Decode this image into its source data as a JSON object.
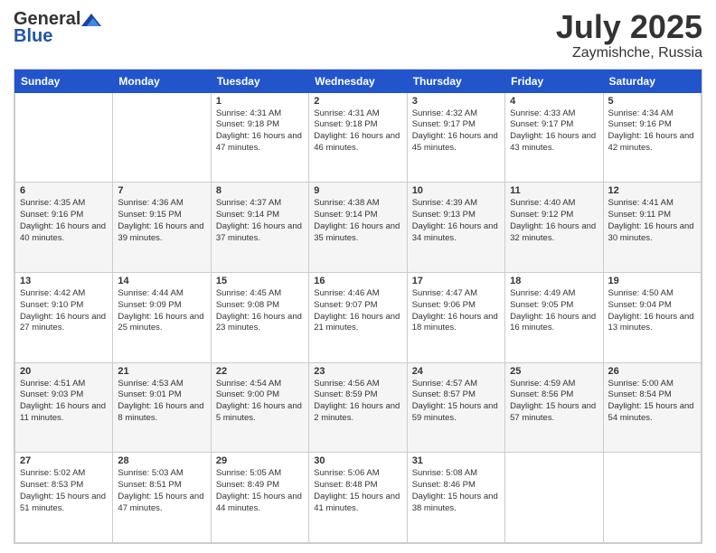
{
  "header": {
    "logo_general": "General",
    "logo_blue": "Blue",
    "month_title": "July 2025",
    "location": "Zaymishche, Russia"
  },
  "calendar": {
    "days_of_week": [
      "Sunday",
      "Monday",
      "Tuesday",
      "Wednesday",
      "Thursday",
      "Friday",
      "Saturday"
    ],
    "weeks": [
      [
        {
          "day": "",
          "info": ""
        },
        {
          "day": "",
          "info": ""
        },
        {
          "day": "1",
          "info": "Sunrise: 4:31 AM\nSunset: 9:18 PM\nDaylight: 16 hours and 47 minutes."
        },
        {
          "day": "2",
          "info": "Sunrise: 4:31 AM\nSunset: 9:18 PM\nDaylight: 16 hours and 46 minutes."
        },
        {
          "day": "3",
          "info": "Sunrise: 4:32 AM\nSunset: 9:17 PM\nDaylight: 16 hours and 45 minutes."
        },
        {
          "day": "4",
          "info": "Sunrise: 4:33 AM\nSunset: 9:17 PM\nDaylight: 16 hours and 43 minutes."
        },
        {
          "day": "5",
          "info": "Sunrise: 4:34 AM\nSunset: 9:16 PM\nDaylight: 16 hours and 42 minutes."
        }
      ],
      [
        {
          "day": "6",
          "info": "Sunrise: 4:35 AM\nSunset: 9:16 PM\nDaylight: 16 hours and 40 minutes."
        },
        {
          "day": "7",
          "info": "Sunrise: 4:36 AM\nSunset: 9:15 PM\nDaylight: 16 hours and 39 minutes."
        },
        {
          "day": "8",
          "info": "Sunrise: 4:37 AM\nSunset: 9:14 PM\nDaylight: 16 hours and 37 minutes."
        },
        {
          "day": "9",
          "info": "Sunrise: 4:38 AM\nSunset: 9:14 PM\nDaylight: 16 hours and 35 minutes."
        },
        {
          "day": "10",
          "info": "Sunrise: 4:39 AM\nSunset: 9:13 PM\nDaylight: 16 hours and 34 minutes."
        },
        {
          "day": "11",
          "info": "Sunrise: 4:40 AM\nSunset: 9:12 PM\nDaylight: 16 hours and 32 minutes."
        },
        {
          "day": "12",
          "info": "Sunrise: 4:41 AM\nSunset: 9:11 PM\nDaylight: 16 hours and 30 minutes."
        }
      ],
      [
        {
          "day": "13",
          "info": "Sunrise: 4:42 AM\nSunset: 9:10 PM\nDaylight: 16 hours and 27 minutes."
        },
        {
          "day": "14",
          "info": "Sunrise: 4:44 AM\nSunset: 9:09 PM\nDaylight: 16 hours and 25 minutes."
        },
        {
          "day": "15",
          "info": "Sunrise: 4:45 AM\nSunset: 9:08 PM\nDaylight: 16 hours and 23 minutes."
        },
        {
          "day": "16",
          "info": "Sunrise: 4:46 AM\nSunset: 9:07 PM\nDaylight: 16 hours and 21 minutes."
        },
        {
          "day": "17",
          "info": "Sunrise: 4:47 AM\nSunset: 9:06 PM\nDaylight: 16 hours and 18 minutes."
        },
        {
          "day": "18",
          "info": "Sunrise: 4:49 AM\nSunset: 9:05 PM\nDaylight: 16 hours and 16 minutes."
        },
        {
          "day": "19",
          "info": "Sunrise: 4:50 AM\nSunset: 9:04 PM\nDaylight: 16 hours and 13 minutes."
        }
      ],
      [
        {
          "day": "20",
          "info": "Sunrise: 4:51 AM\nSunset: 9:03 PM\nDaylight: 16 hours and 11 minutes."
        },
        {
          "day": "21",
          "info": "Sunrise: 4:53 AM\nSunset: 9:01 PM\nDaylight: 16 hours and 8 minutes."
        },
        {
          "day": "22",
          "info": "Sunrise: 4:54 AM\nSunset: 9:00 PM\nDaylight: 16 hours and 5 minutes."
        },
        {
          "day": "23",
          "info": "Sunrise: 4:56 AM\nSunset: 8:59 PM\nDaylight: 16 hours and 2 minutes."
        },
        {
          "day": "24",
          "info": "Sunrise: 4:57 AM\nSunset: 8:57 PM\nDaylight: 15 hours and 59 minutes."
        },
        {
          "day": "25",
          "info": "Sunrise: 4:59 AM\nSunset: 8:56 PM\nDaylight: 15 hours and 57 minutes."
        },
        {
          "day": "26",
          "info": "Sunrise: 5:00 AM\nSunset: 8:54 PM\nDaylight: 15 hours and 54 minutes."
        }
      ],
      [
        {
          "day": "27",
          "info": "Sunrise: 5:02 AM\nSunset: 8:53 PM\nDaylight: 15 hours and 51 minutes."
        },
        {
          "day": "28",
          "info": "Sunrise: 5:03 AM\nSunset: 8:51 PM\nDaylight: 15 hours and 47 minutes."
        },
        {
          "day": "29",
          "info": "Sunrise: 5:05 AM\nSunset: 8:49 PM\nDaylight: 15 hours and 44 minutes."
        },
        {
          "day": "30",
          "info": "Sunrise: 5:06 AM\nSunset: 8:48 PM\nDaylight: 15 hours and 41 minutes."
        },
        {
          "day": "31",
          "info": "Sunrise: 5:08 AM\nSunset: 8:46 PM\nDaylight: 15 hours and 38 minutes."
        },
        {
          "day": "",
          "info": ""
        },
        {
          "day": "",
          "info": ""
        }
      ]
    ]
  }
}
